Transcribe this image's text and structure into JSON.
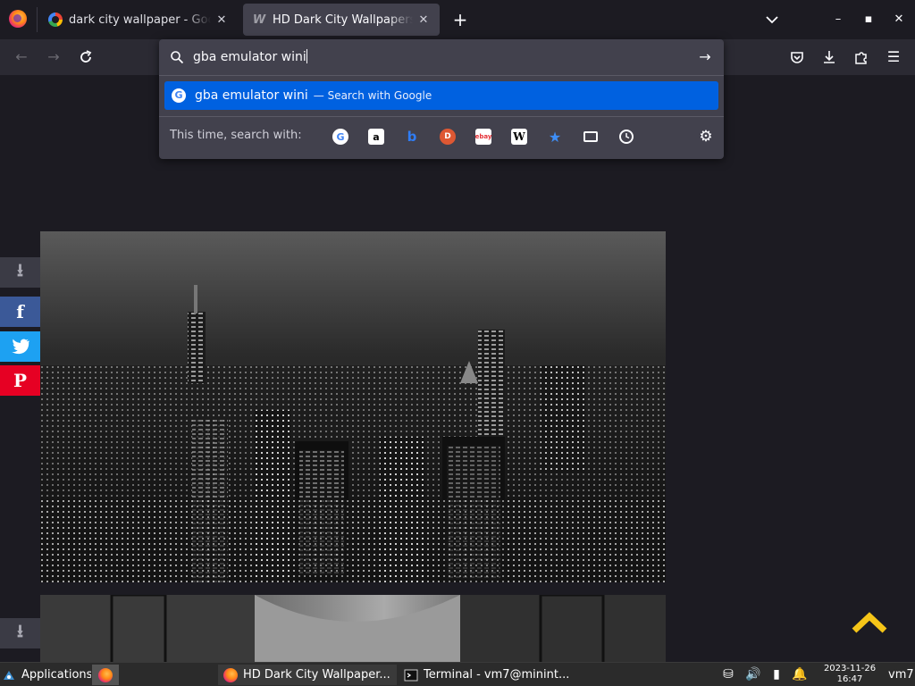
{
  "browser": {
    "tabs": [
      {
        "title": "dark city wallpaper - Google Search",
        "favicon": "google-g-icon"
      },
      {
        "title": "HD Dark City Wallpapers",
        "favicon": "wallpaper-w-icon"
      }
    ],
    "new_tab": "+",
    "window_controls": {
      "minimize": "–",
      "maximize": "▪",
      "close": "✕"
    }
  },
  "urlbar": {
    "query": "gba emulator wini",
    "suggestion": {
      "text": "gba emulator wini",
      "action": "— Search with Google"
    },
    "one_off_label": "This time, search with:",
    "engines": [
      {
        "name": "Google",
        "glyph": "G"
      },
      {
        "name": "Amazon",
        "glyph": "a"
      },
      {
        "name": "Bing",
        "glyph": "b"
      },
      {
        "name": "DuckDuckGo",
        "glyph": "D"
      },
      {
        "name": "eBay",
        "glyph": "ebay"
      },
      {
        "name": "Wikipedia",
        "glyph": "W"
      },
      {
        "name": "Bookmarks",
        "glyph": "★"
      },
      {
        "name": "Tabs",
        "glyph": ""
      },
      {
        "name": "History",
        "glyph": ""
      }
    ]
  },
  "page": {
    "share": {
      "facebook": "f",
      "pinterest": "P"
    },
    "accent": "#f5c518"
  },
  "taskbar": {
    "applications": "Applications",
    "tasks": [
      {
        "title": "HD Dark City Wallpaper..."
      },
      {
        "title": "Terminal - vm7@minint..."
      }
    ],
    "date": "2023-11-26",
    "time": "16:47",
    "user": "vm7"
  },
  "colors": {
    "selection": "#0061e0",
    "toolbar": "#2b2a33",
    "panel": "#42414d"
  }
}
